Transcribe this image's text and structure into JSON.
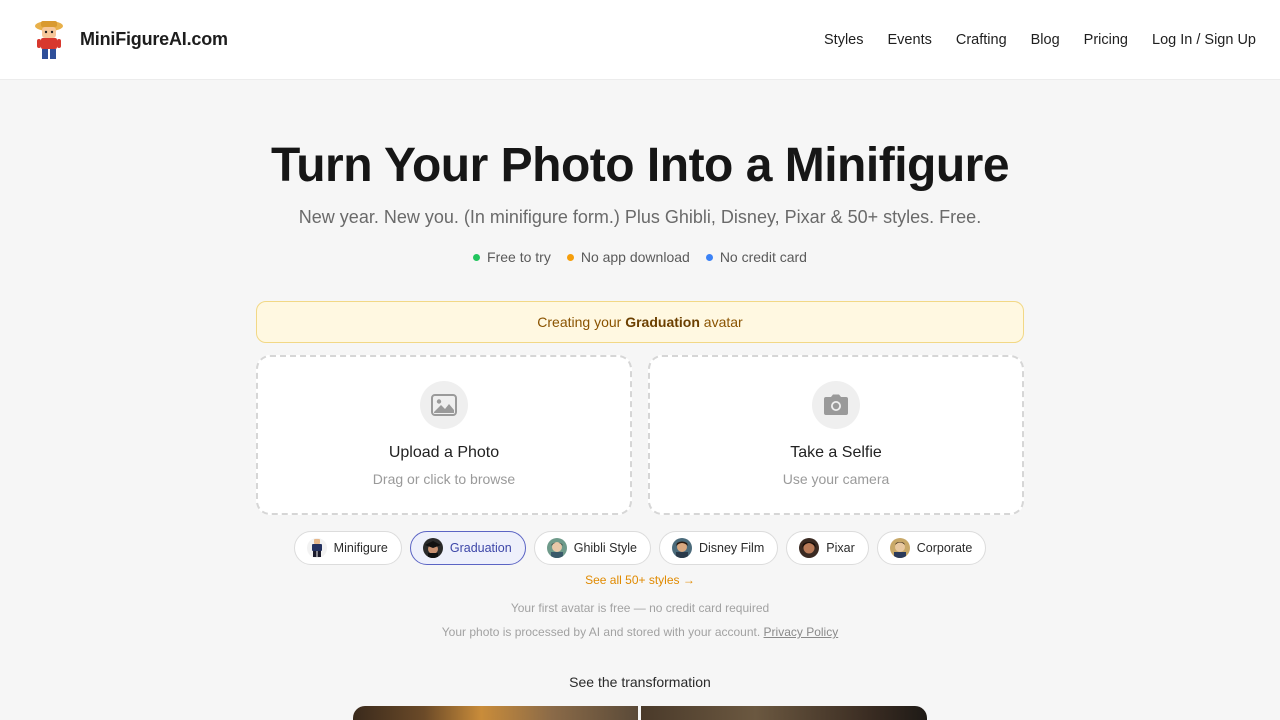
{
  "header": {
    "brand": "MiniFigureAI.com",
    "nav": [
      "Styles",
      "Events",
      "Crafting",
      "Blog",
      "Pricing",
      "Log In / Sign Up"
    ]
  },
  "hero": {
    "title": "Turn Your Photo Into a Minifigure",
    "subtitle": "New year. New you. (In minifigure form.) Plus Ghibli, Disney, Pixar & 50+ styles. Free.",
    "badges": [
      {
        "label": "Free to try",
        "color": "#22c55e"
      },
      {
        "label": "No app download",
        "color": "#f59e0b"
      },
      {
        "label": "No credit card",
        "color": "#3b82f6"
      }
    ]
  },
  "banner": {
    "prefix": "Creating your",
    "highlight": "Graduation",
    "suffix": "avatar"
  },
  "upload": {
    "title": "Upload a Photo",
    "subtitle": "Drag or click to browse",
    "icon": "image-icon"
  },
  "selfie": {
    "title": "Take a Selfie",
    "subtitle": "Use your camera",
    "icon": "camera-icon"
  },
  "styles": [
    {
      "label": "Minifigure",
      "active": false
    },
    {
      "label": "Graduation",
      "active": true
    },
    {
      "label": "Ghibli Style",
      "active": false
    },
    {
      "label": "Disney Film",
      "active": false
    },
    {
      "label": "Pixar",
      "active": false
    },
    {
      "label": "Corporate",
      "active": false
    }
  ],
  "see_all": "See all 50+ styles →",
  "note_free": "Your first avatar is free — no credit card required",
  "note_privacy": "Your photo is processed by AI and stored with your account.",
  "privacy_link": "Privacy Policy",
  "transformation_title": "See the transformation",
  "colors": {
    "accent": "#5b64c4",
    "banner_bg": "#fff8e1",
    "link_orange": "#e08a00"
  }
}
